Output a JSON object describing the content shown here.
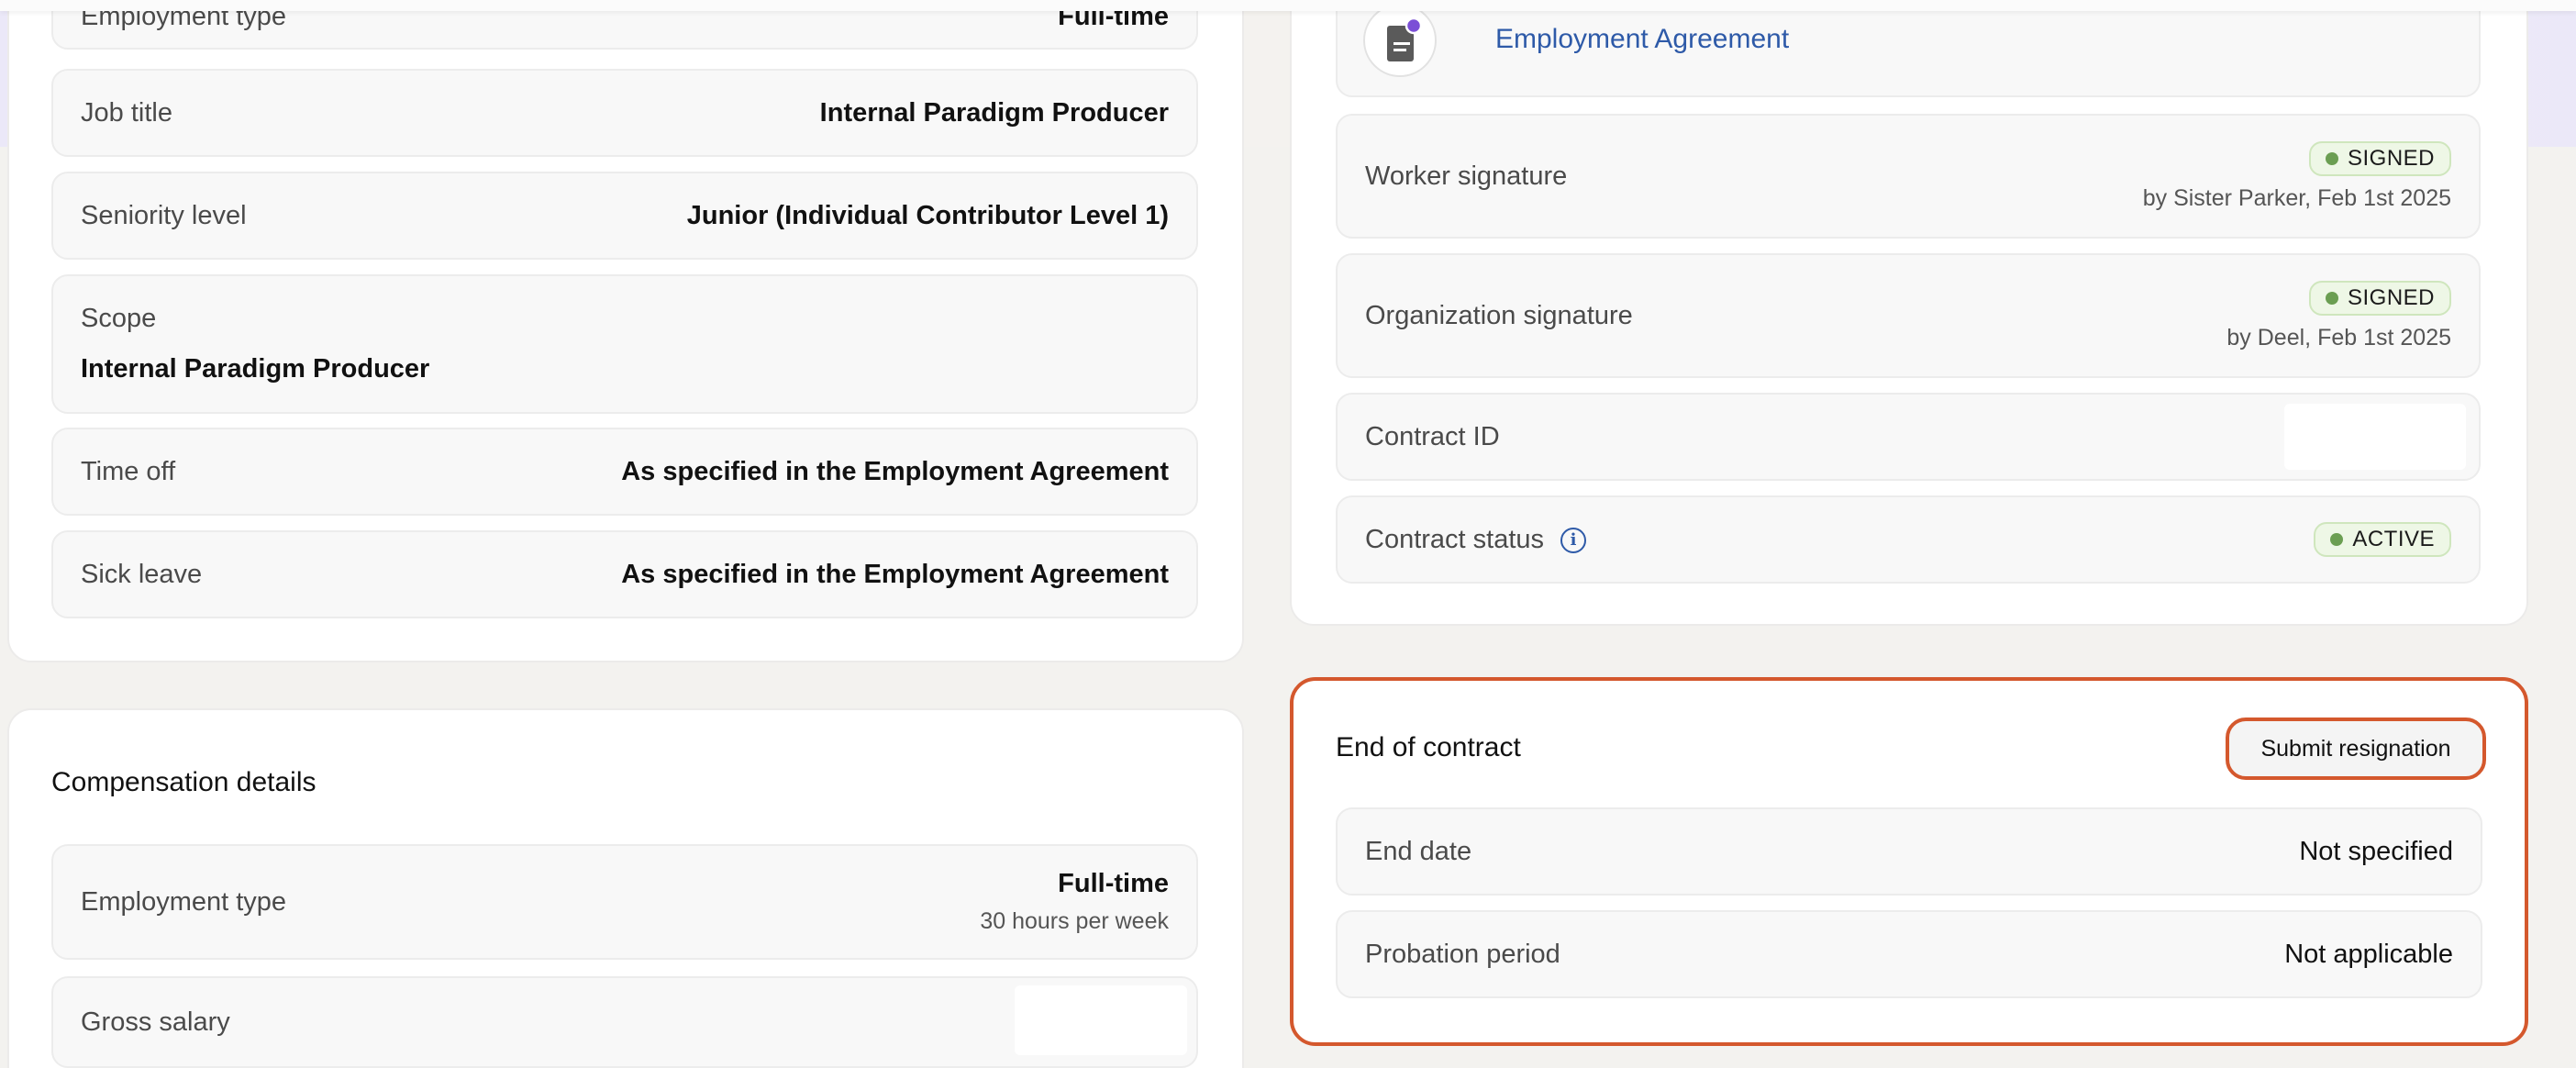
{
  "left_card_top": {
    "rows": [
      {
        "label": "Employment type",
        "value": "Full-time"
      },
      {
        "label": "Job title",
        "value": "Internal Paradigm Producer"
      },
      {
        "label": "Seniority level",
        "value": "Junior (Individual Contributor Level 1)"
      },
      {
        "label": "Scope",
        "value": "Internal Paradigm Producer"
      },
      {
        "label": "Time off",
        "value": "As specified in the Employment Agreement"
      },
      {
        "label": "Sick leave",
        "value": "As specified in the Employment Agreement"
      }
    ]
  },
  "compensation": {
    "title": "Compensation details",
    "employment_type": {
      "label": "Employment type",
      "value": "Full-time",
      "sub": "30 hours per week"
    },
    "gross_salary": {
      "label": "Gross salary"
    }
  },
  "contract_card": {
    "document_link": "Employment Agreement",
    "document_icon": "document-icon",
    "worker_signature": {
      "label": "Worker signature",
      "badge": "SIGNED",
      "by": "by Sister Parker, Feb 1st 2025"
    },
    "org_signature": {
      "label": "Organization signature",
      "badge": "SIGNED",
      "by": "by Deel, Feb 1st 2025"
    },
    "contract_id": {
      "label": "Contract ID"
    },
    "contract_status": {
      "label": "Contract status",
      "badge": "ACTIVE",
      "info_icon": "info-icon"
    },
    "badge_color": "#6b9e52"
  },
  "end_of_contract": {
    "title": "End of contract",
    "submit_button": "Submit resignation",
    "end_date": {
      "label": "End date",
      "value": "Not specified"
    },
    "probation": {
      "label": "Probation period",
      "value": "Not applicable"
    },
    "highlight_color": "#d4582d"
  }
}
